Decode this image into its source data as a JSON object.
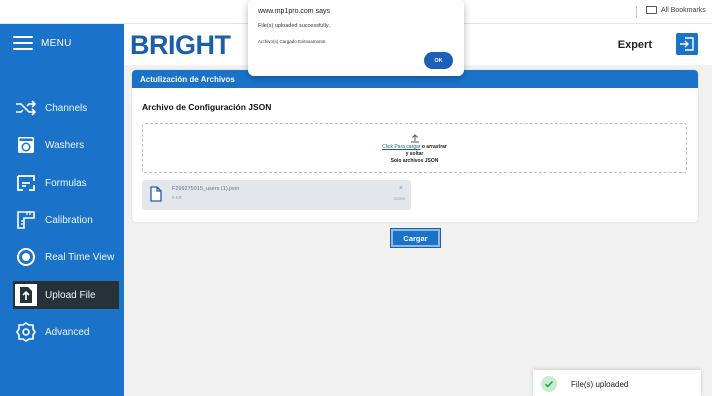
{
  "browser": {
    "bookmarks_label": "All Bookmarks"
  },
  "sidebar": {
    "menu_label": "MENU",
    "items": [
      {
        "label": "Channels",
        "icon": "shuffle-icon"
      },
      {
        "label": "Washers",
        "icon": "washer-icon"
      },
      {
        "label": "Formulas",
        "icon": "formulas-icon"
      },
      {
        "label": "Calibration",
        "icon": "ruler-icon"
      },
      {
        "label": "Real Time View",
        "icon": "radio-target-icon"
      },
      {
        "label": "Upload File",
        "icon": "upload-file-icon",
        "active": true
      },
      {
        "label": "Advanced",
        "icon": "gear-icon"
      }
    ]
  },
  "header": {
    "logo_text": "BRIGHT",
    "user_role": "Expert",
    "logout_icon": "logout-icon"
  },
  "card": {
    "title": "Actulización de Archivos",
    "section_title": "Archivo de Configuración JSON",
    "dropzone": {
      "link_text": "Click Para cargar",
      "after_link": " o arrastrar",
      "line2": "y soltar",
      "line3": "Solo archivos JSON"
    },
    "file": {
      "name": "F299275915_users (1).json",
      "size": "5 KB",
      "status": "Done",
      "close": "×"
    }
  },
  "upload_button_label": "Cargar",
  "dialog": {
    "title": "www.mp1pro.com says",
    "line1": "File(s) uploaded successfully.",
    "line2": "Archivo(s) Cargado Exitosamente.",
    "ok_label": "OK"
  },
  "toast": {
    "text": "File(s) uploaded"
  },
  "colors": {
    "primary": "#1a73c9",
    "sidebar_active": "#263238",
    "logo": "#1a5fa8"
  }
}
